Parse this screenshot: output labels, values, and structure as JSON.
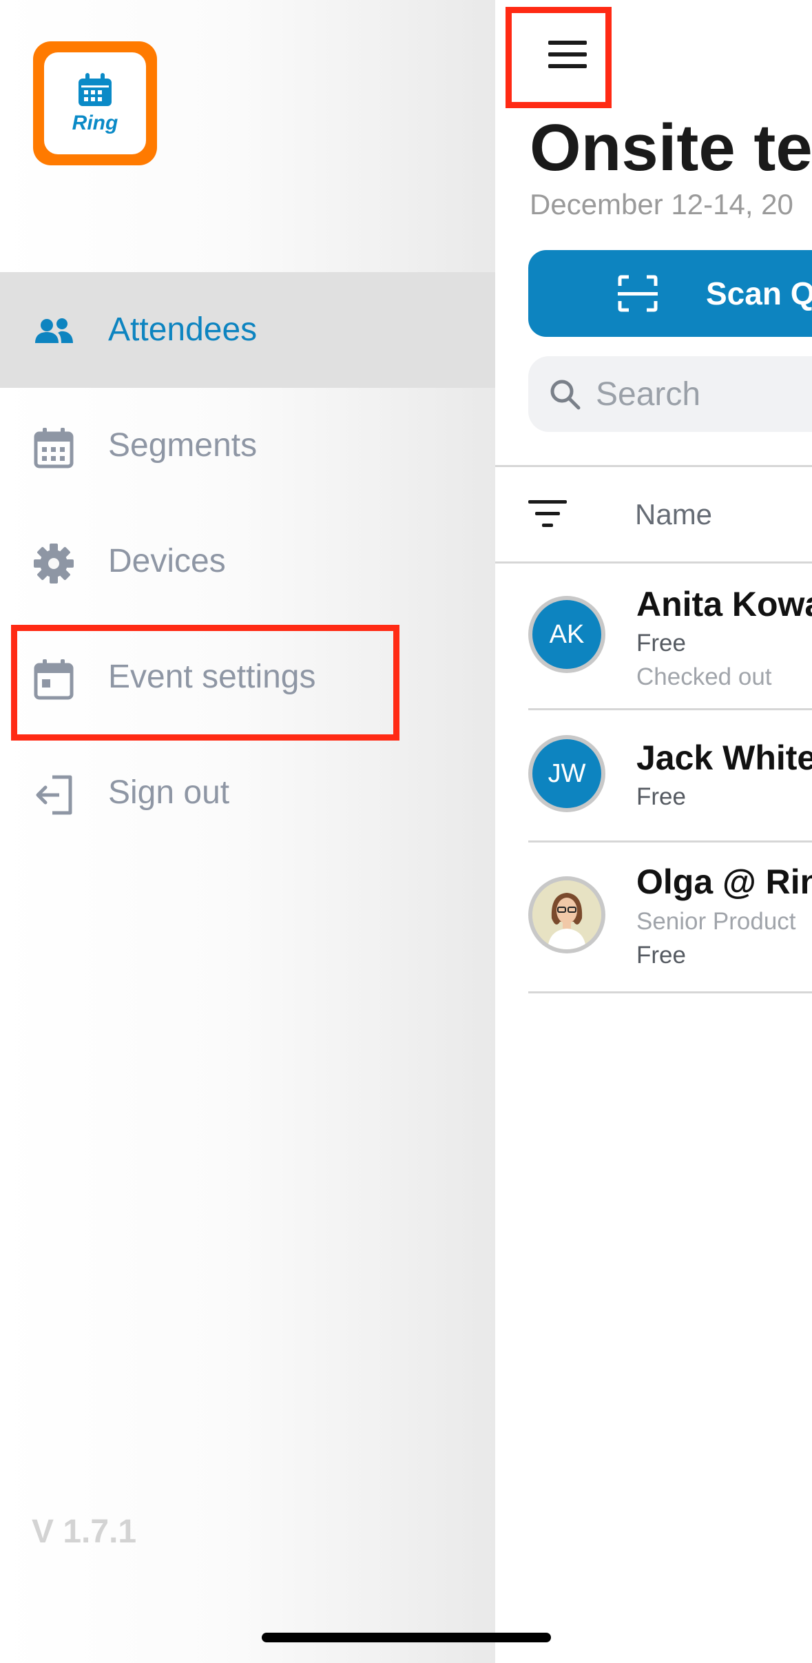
{
  "app": {
    "logo_text": "Ring",
    "version": "V 1.7.1"
  },
  "sidebar": {
    "items": [
      {
        "label": "Attendees",
        "icon": "people-icon",
        "active": true
      },
      {
        "label": "Segments",
        "icon": "calendar-grid-icon",
        "active": false
      },
      {
        "label": "Devices",
        "icon": "gear-icon",
        "active": false
      },
      {
        "label": "Event settings",
        "icon": "calendar-icon",
        "active": false
      },
      {
        "label": "Sign out",
        "icon": "sign-out-icon",
        "active": false
      }
    ]
  },
  "main": {
    "title": "Onsite te",
    "date": "December 12-14, 20",
    "scan_button_label": "Scan QR",
    "search_placeholder": "Search",
    "list_header": {
      "column": "Name"
    },
    "attendees": [
      {
        "initials": "AK",
        "name": "Anita Kowa",
        "lines": [
          "Free",
          "Checked out"
        ]
      },
      {
        "initials": "JW",
        "name": "Jack White",
        "lines": [
          "Free"
        ]
      },
      {
        "initials": "",
        "name": "Olga @ Rin",
        "lines": [
          "Senior Product",
          "Free"
        ],
        "has_photo": true
      }
    ]
  },
  "colors": {
    "accent": "#0d84c0",
    "brand_orange": "#ff7a00",
    "highlight": "#ff2a14",
    "inactive_text": "#8e96a4"
  }
}
